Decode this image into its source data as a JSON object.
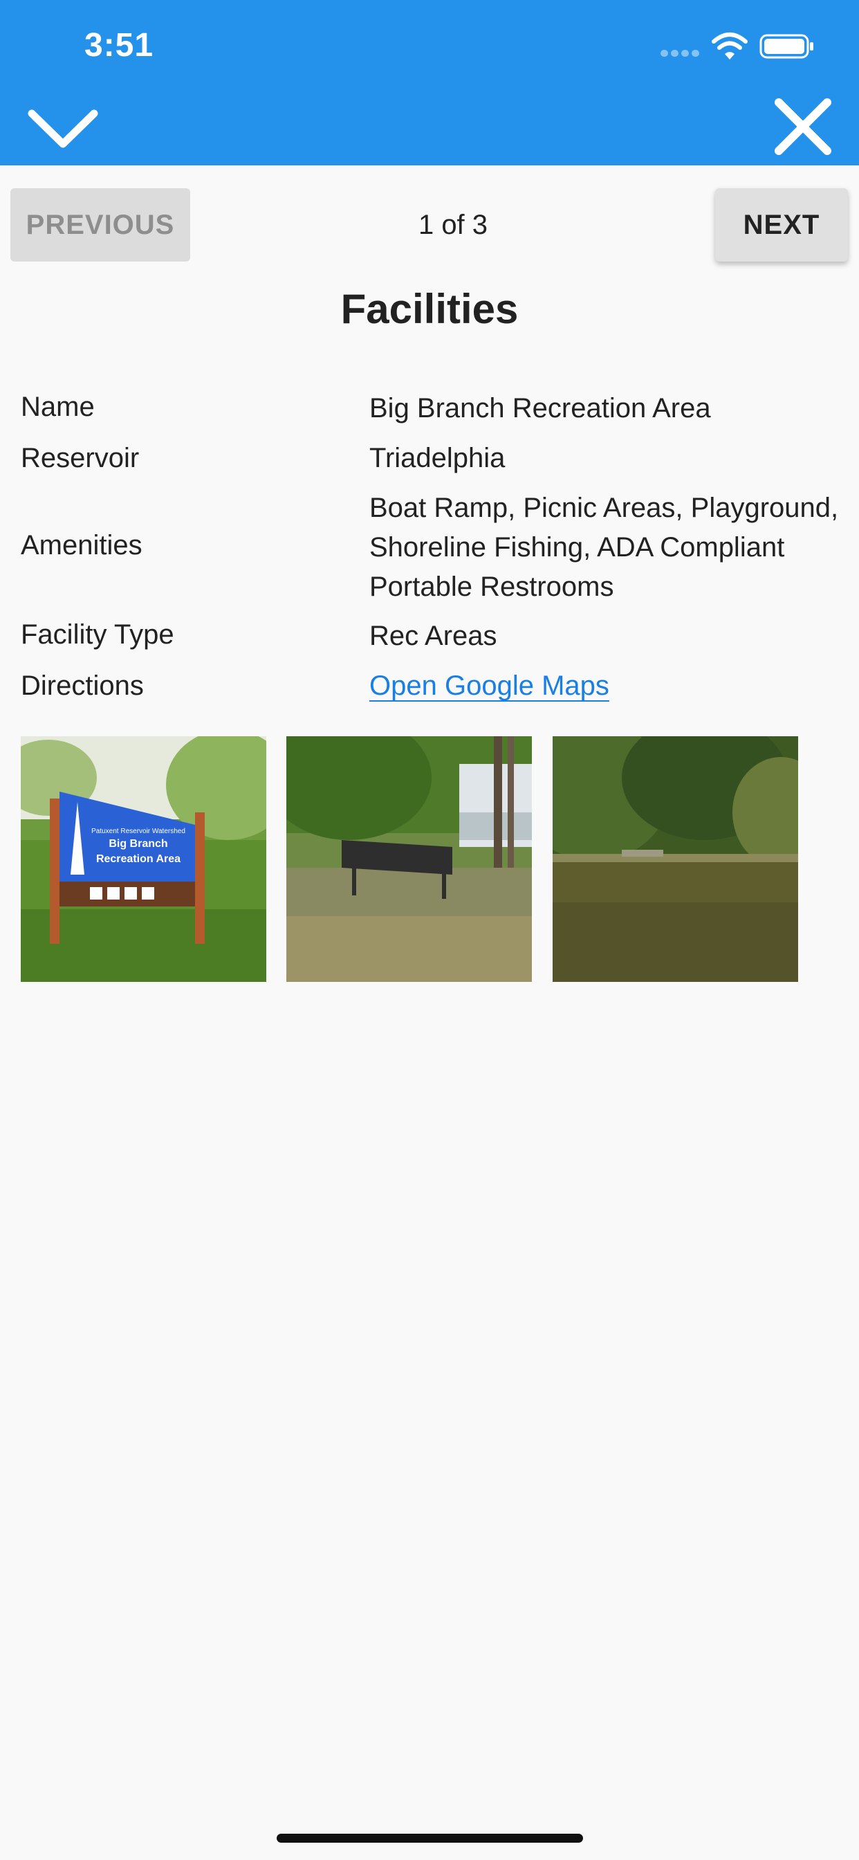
{
  "status_bar": {
    "time": "3:51"
  },
  "header": {
    "collapse_icon": "chevron-down-icon",
    "close_icon": "close-icon",
    "background_color": "#2492ea"
  },
  "pager": {
    "previous_label": "PREVIOUS",
    "next_label": "NEXT",
    "indicator": "1 of 3"
  },
  "section": {
    "title": "Facilities"
  },
  "details": [
    {
      "label": "Name",
      "value": "Big Branch Recreation Area"
    },
    {
      "label": "Reservoir",
      "value": "Triadelphia"
    },
    {
      "label": "Amenities",
      "value": "Boat Ramp, Picnic Areas, Playground, Shoreline Fishing, ADA Compliant Portable Restrooms"
    },
    {
      "label": "Facility Type",
      "value": "Rec Areas"
    },
    {
      "label": "Directions",
      "value": "Open Google Maps"
    }
  ],
  "photos": {
    "sign": {
      "line1": "Patuxent Reservoir Watershed",
      "line2": "Big Branch",
      "line3": "Recreation Area"
    }
  },
  "colors": {
    "accent": "#2492ea",
    "link": "#1a7fe3"
  }
}
